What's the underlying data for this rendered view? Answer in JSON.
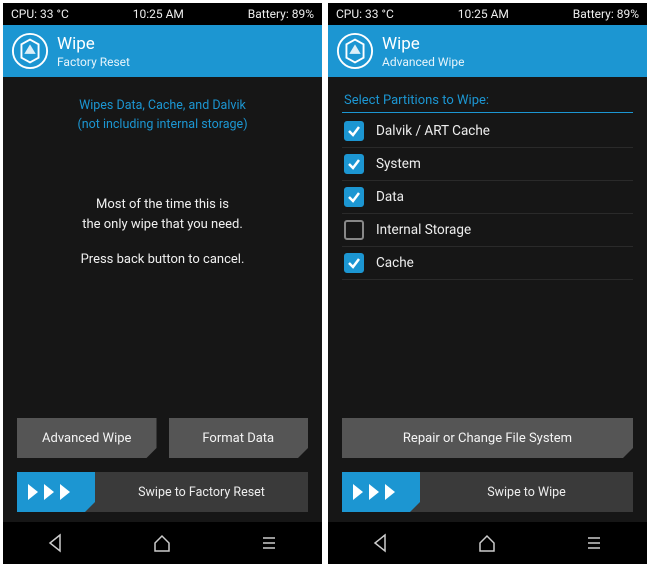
{
  "status": {
    "cpu": "CPU: 33 °C",
    "time": "10:25 AM",
    "battery": "Battery: 89%"
  },
  "left": {
    "title": "Wipe",
    "subtitle": "Factory Reset",
    "info_line1": "Wipes Data, Cache, and Dalvik",
    "info_line2": "(not including internal storage)",
    "body_line1": "Most of the time this is",
    "body_line2": "the only wipe that you need.",
    "body_line3": "Press back button to cancel.",
    "btn_advanced": "Advanced Wipe",
    "btn_format": "Format Data",
    "swipe_label": "Swipe to Factory Reset"
  },
  "right": {
    "title": "Wipe",
    "subtitle": "Advanced Wipe",
    "section_label": "Select Partitions to Wipe:",
    "partitions": [
      {
        "label": "Dalvik / ART Cache",
        "checked": true
      },
      {
        "label": "System",
        "checked": true
      },
      {
        "label": "Data",
        "checked": true
      },
      {
        "label": "Internal Storage",
        "checked": false
      },
      {
        "label": "Cache",
        "checked": true
      }
    ],
    "btn_repair": "Repair or Change File System",
    "swipe_label": "Swipe to Wipe"
  },
  "colors": {
    "accent": "#1c96d2"
  }
}
